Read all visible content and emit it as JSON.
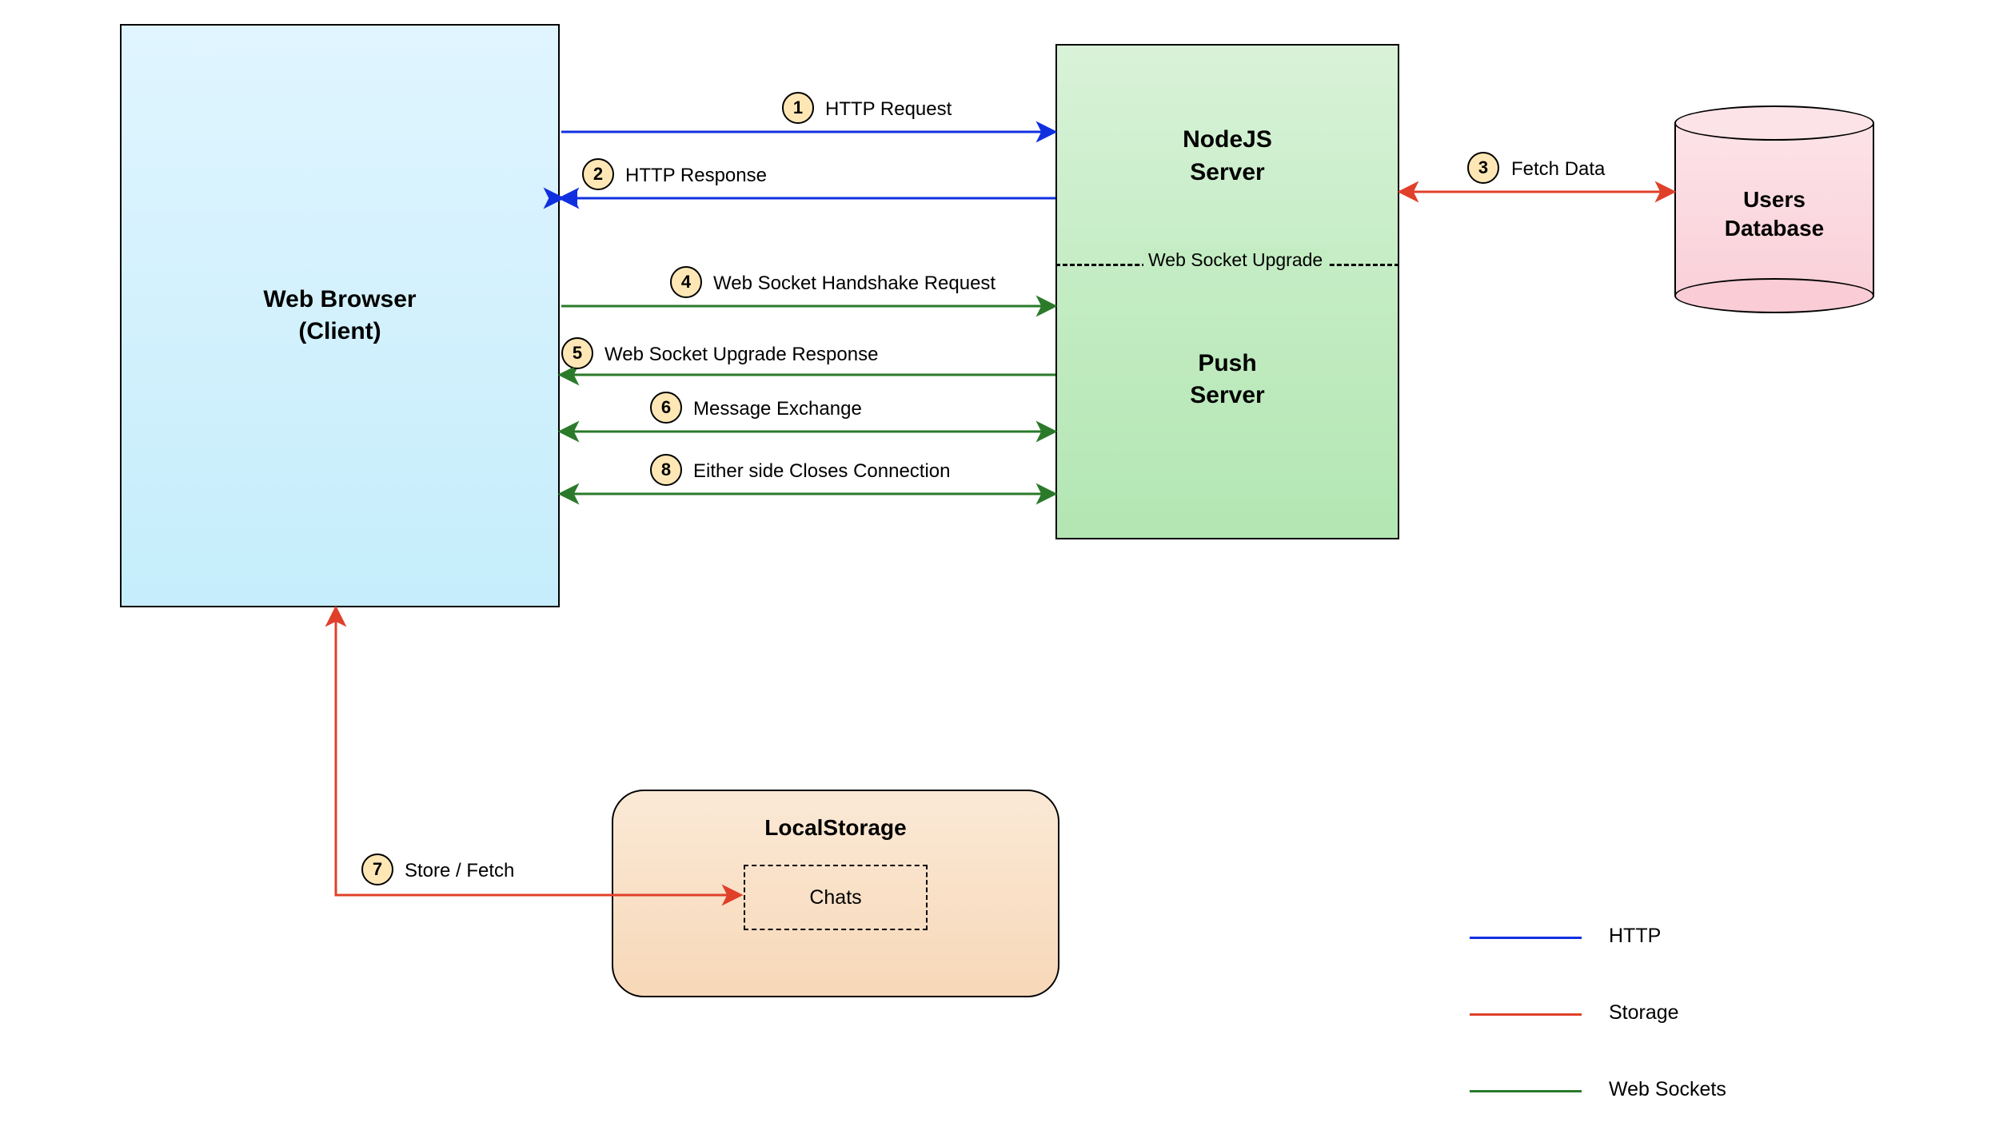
{
  "nodes": {
    "browser": {
      "line1": "Web Browser",
      "line2": "(Client)"
    },
    "nodejs": {
      "line1": "NodeJS",
      "line2": "Server"
    },
    "push": {
      "line1": "Push",
      "line2": "Server"
    },
    "ws_upgrade": "Web Socket Upgrade",
    "localstorage": "LocalStorage",
    "chats": "Chats",
    "db": {
      "line1": "Users",
      "line2": "Database"
    }
  },
  "steps": {
    "s1": {
      "num": "1",
      "label": "HTTP Request"
    },
    "s2": {
      "num": "2",
      "label": "HTTP Response"
    },
    "s3": {
      "num": "3",
      "label": "Fetch Data"
    },
    "s4": {
      "num": "4",
      "label": "Web Socket Handshake Request"
    },
    "s5": {
      "num": "5",
      "label": "Web Socket Upgrade Response"
    },
    "s6": {
      "num": "6",
      "label": "Message Exchange"
    },
    "s7": {
      "num": "7",
      "label": "Store / Fetch"
    },
    "s8": {
      "num": "8",
      "label": "Either side Closes Connection"
    }
  },
  "legend": {
    "http": "HTTP",
    "storage": "Storage",
    "ws": "Web Sockets"
  },
  "colors": {
    "http": "#1030e0",
    "storage": "#e0402a",
    "ws": "#2a7a2a"
  }
}
